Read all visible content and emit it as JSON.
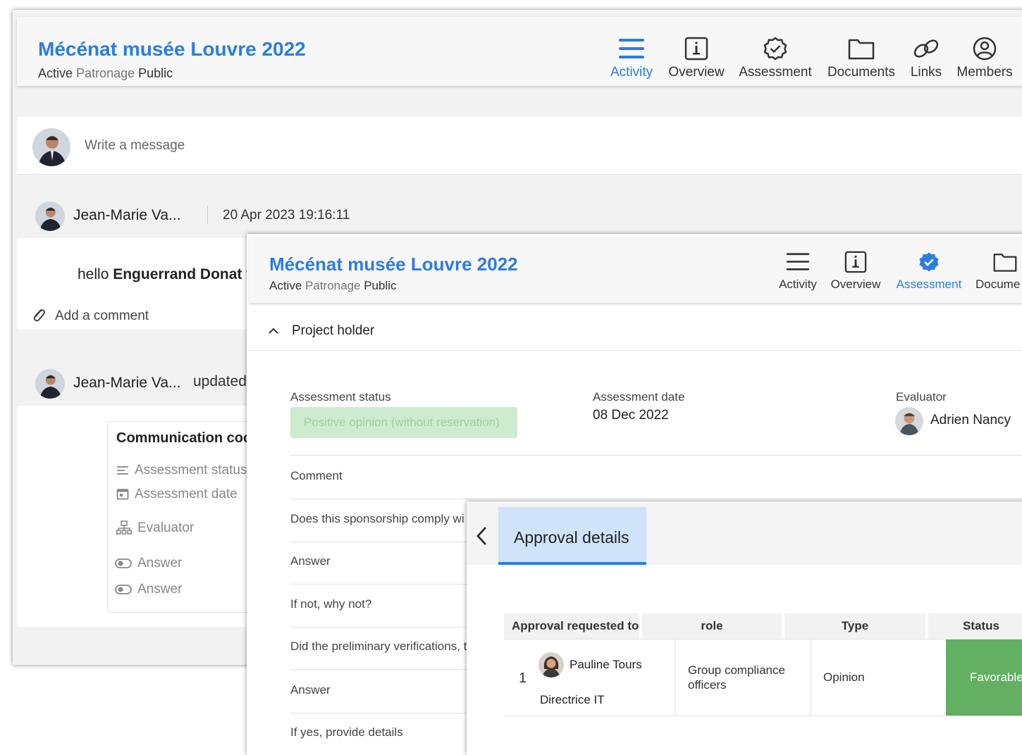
{
  "windows": {
    "back": {
      "title": "Mécénat musée Louvre 2022",
      "subtitle": {
        "status": "Active",
        "category": "Patronage",
        "visibility": "Public"
      },
      "nav": [
        {
          "label": "Activity",
          "icon": "menu-lines-icon",
          "active": true
        },
        {
          "label": "Overview",
          "icon": "info-icon",
          "active": false
        },
        {
          "label": "Assessment",
          "icon": "badge-check-icon",
          "active": false
        },
        {
          "label": "Documents",
          "icon": "folder-icon",
          "active": false
        },
        {
          "label": "Links",
          "icon": "link-icon",
          "active": false
        },
        {
          "label": "Members",
          "icon": "user-circle-icon",
          "active": false
        }
      ],
      "composer": {
        "placeholder": "Write a message"
      },
      "post1": {
        "author": "Jean-Marie Va...",
        "date": "20 Apr 2023 19:16:11",
        "body_prefix": "hello",
        "body_mention": "Enguerrand Donat",
        "body_suffix": "w",
        "add_comment": "Add a comment"
      },
      "post2": {
        "author": "Jean-Marie Va...",
        "action": "updated",
        "card_title": "Communication coc",
        "fields": [
          {
            "icon": "list-lines-icon",
            "label": "Assessment status"
          },
          {
            "icon": "calendar-icon",
            "label": "Assessment date"
          },
          {
            "icon": "org-chart-icon",
            "label": "Evaluator"
          },
          {
            "icon": "toggle-icon",
            "label": "Answer"
          },
          {
            "icon": "toggle-icon",
            "label": "Answer"
          }
        ]
      }
    },
    "middle": {
      "title": "Mécénat musée Louvre 2022",
      "subtitle": {
        "status": "Active",
        "category": "Patronage",
        "visibility": "Public"
      },
      "nav": [
        {
          "label": "Activity",
          "icon": "menu-lines-icon",
          "active": false
        },
        {
          "label": "Overview",
          "icon": "info-icon",
          "active": false
        },
        {
          "label": "Assessment",
          "icon": "badge-check-icon",
          "active": true
        },
        {
          "label": "Docume",
          "icon": "folder-icon",
          "active": false
        }
      ],
      "section_title": "Project holder",
      "assessment_status_label": "Assessment status",
      "assessment_status_value": "Positive opinion (without reservation)",
      "assessment_date_label": "Assessment date",
      "assessment_date_value": "08 Dec 2022",
      "evaluator_label": "Evaluator",
      "evaluator_name": "Adrien Nancy",
      "rows": [
        "Comment",
        "Does this sponsorship comply wi",
        "Answer",
        "If not, why not?",
        "Did the preliminary verifications, t",
        "Answer",
        "If yes, provide details"
      ]
    },
    "front": {
      "tab_title": "Approval details",
      "table": {
        "headers": [
          "Approval requested to",
          "role",
          "Type",
          "Status"
        ],
        "rows": [
          {
            "index": "1",
            "name": "Pauline Tours",
            "job": "Directrice IT",
            "role": "Group compliance officers",
            "type": "Opinion",
            "status": "Favorable"
          }
        ]
      }
    }
  },
  "colors": {
    "accent": "#2b7de0",
    "status_positive_bg": "#cdeccf",
    "status_positive_text": "#9bd39f",
    "favorable_bg": "#63b062",
    "tab_active_bg": "#cfe3fa"
  }
}
